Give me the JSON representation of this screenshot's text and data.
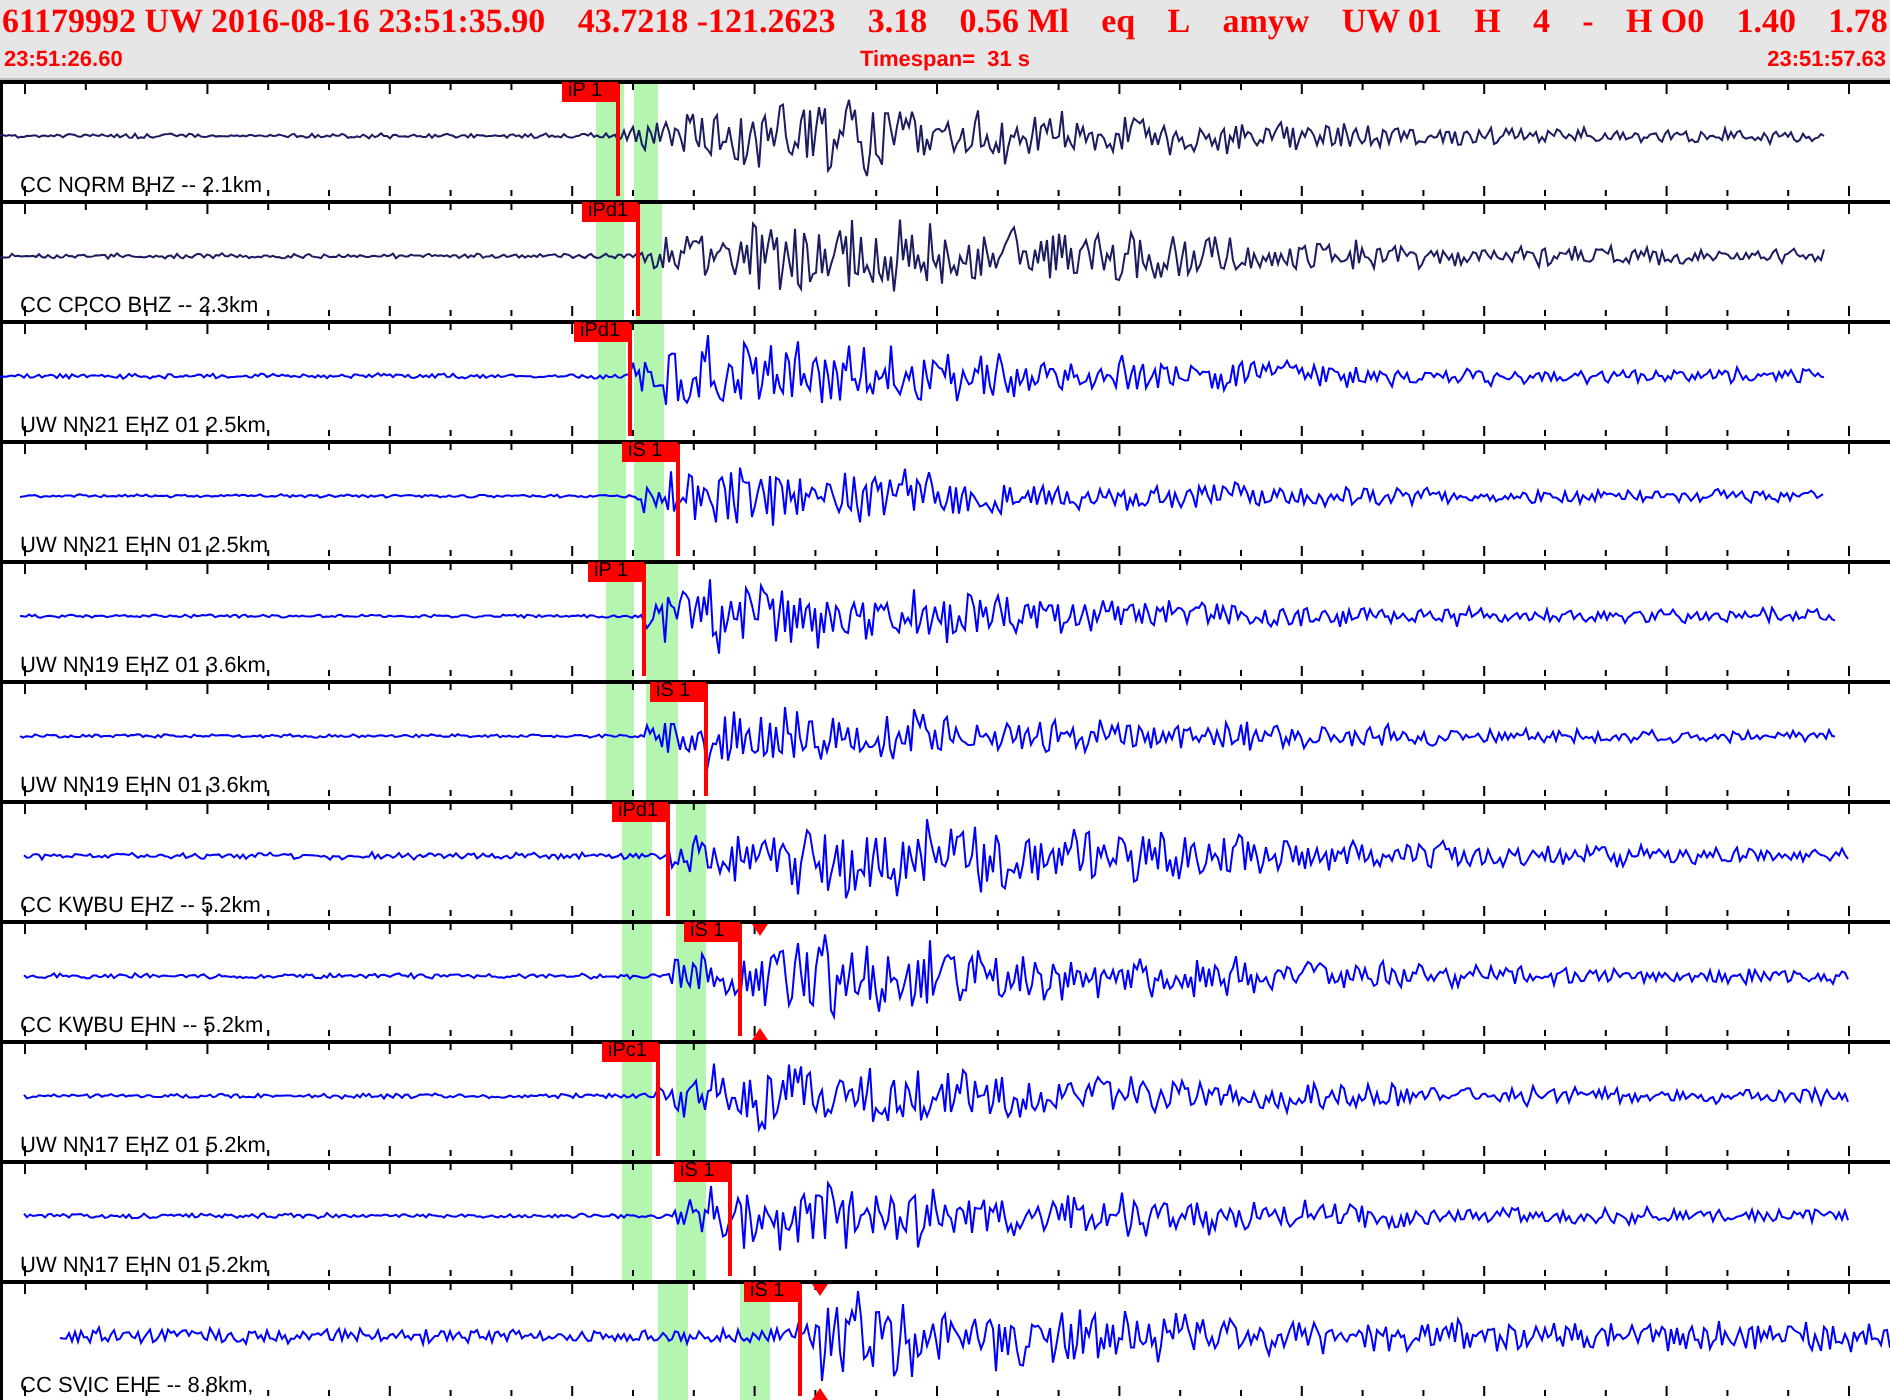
{
  "header": {
    "fields": [
      "61179992 UW 2016-08-16 23:51:35.90",
      "43.7218 -121.2623",
      "3.18",
      "0.56 Ml",
      "eq",
      "L",
      "amyw",
      "UW 01",
      "H",
      "4",
      "-",
      "H O0",
      "1.40",
      "1.78"
    ],
    "start_time": "23:51:26.60",
    "timespan": "Timespan=  31 s",
    "end_time": "23:51:57.63"
  },
  "traces": [
    {
      "label": "CC NORM BHZ -- 2.1km",
      "color": "#1c1c60",
      "marked": false,
      "picks": [
        {
          "label": "iP 1"
        }
      ]
    },
    {
      "label": "CC CPCO BHZ -- 2.3km",
      "color": "#1c1c60",
      "marked": false,
      "picks": [
        {
          "label": "iPd1"
        }
      ]
    },
    {
      "label": "UW NN21 EHZ 01 2.5km",
      "color": "#0000ff",
      "marked": false,
      "picks": [
        {
          "label": "iPd1"
        }
      ]
    },
    {
      "label": "UW NN21 EHN 01 2.5km",
      "color": "#0000ff",
      "marked": false,
      "picks": [
        {
          "label": "iS 1"
        }
      ]
    },
    {
      "label": "UW NN19 EHZ 01 3.6km",
      "color": "#0000ff",
      "marked": false,
      "picks": [
        {
          "label": "iP 1"
        }
      ]
    },
    {
      "label": "UW NN19 EHN 01 3.6km",
      "color": "#0000ff",
      "marked": false,
      "picks": [
        {
          "label": "iS 1"
        }
      ]
    },
    {
      "label": "CC KWBU EHZ -- 5.2km",
      "color": "#0000ff",
      "marked": false,
      "picks": [
        {
          "label": "iPd1"
        }
      ]
    },
    {
      "label": "CC KWBU EHN -- 5.2km",
      "color": "#0000ff",
      "marked": true,
      "picks": [
        {
          "label": "iS 1"
        }
      ]
    },
    {
      "label": "UW NN17 EHZ 01 5.2km",
      "color": "#0000ff",
      "marked": false,
      "picks": [
        {
          "label": "iPc1"
        }
      ]
    },
    {
      "label": "UW NN17 EHN 01 5.2km",
      "color": "#0000ff",
      "marked": false,
      "picks": [
        {
          "label": "iS 1"
        }
      ]
    },
    {
      "label": "CC SVIC EHE -- 8.8km,",
      "color": "#0000ff",
      "marked": true,
      "picks": [
        {
          "label": "iS 1"
        }
      ]
    }
  ]
}
